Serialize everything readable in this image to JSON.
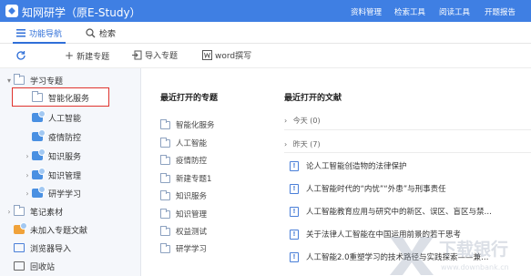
{
  "titlebar": {
    "app_title": "知网研学（原E-Study）",
    "menu": [
      "资料管理",
      "检索工具",
      "阅读工具",
      "开题报告"
    ]
  },
  "tabs": [
    {
      "label": "功能导航"
    },
    {
      "label": "检索"
    }
  ],
  "toolbar": {
    "new_topic": "新建专题",
    "import_topic": "导入专题",
    "word_write": "word撰写"
  },
  "sidebar": {
    "items": [
      {
        "label": "学习专题"
      },
      {
        "label": "智能化服务"
      },
      {
        "label": "人工智能"
      },
      {
        "label": "疫情防控"
      },
      {
        "label": "知识服务"
      },
      {
        "label": "知识管理"
      },
      {
        "label": "研学学习"
      },
      {
        "label": "笔记素材"
      },
      {
        "label": "未加入专题文献"
      },
      {
        "label": "浏览器导入"
      },
      {
        "label": "回收站"
      }
    ]
  },
  "recent_topics": {
    "heading": "最近打开的专题",
    "items": [
      "智能化服务",
      "人工智能",
      "疫情防控",
      "新建专题1",
      "知识服务",
      "知识管理",
      "权益测试",
      "研学学习"
    ]
  },
  "recent_docs": {
    "heading": "最近打开的文献",
    "today": "今天 (0)",
    "yesterday": "昨天 (7)",
    "items": [
      "论人工智能创造物的法律保护",
      "人工智能时代的“内忧”“外患”与刑事责任",
      "人工智能教育应用与研究中的新区、误区、盲区与禁…",
      "关于法律人工智能在中国运用前景的若干思考",
      "人工智能2.0重塑学习的技术路径与实践探索——兼…"
    ]
  },
  "watermark": {
    "text": "下载银行",
    "sub": "www.downbank.cn"
  },
  "colors": {
    "titlebar": "#3f7fe3",
    "accent": "#2f6fd8",
    "highlight_border": "#e0332e",
    "sidebar_bg": "#f5f7fb"
  }
}
